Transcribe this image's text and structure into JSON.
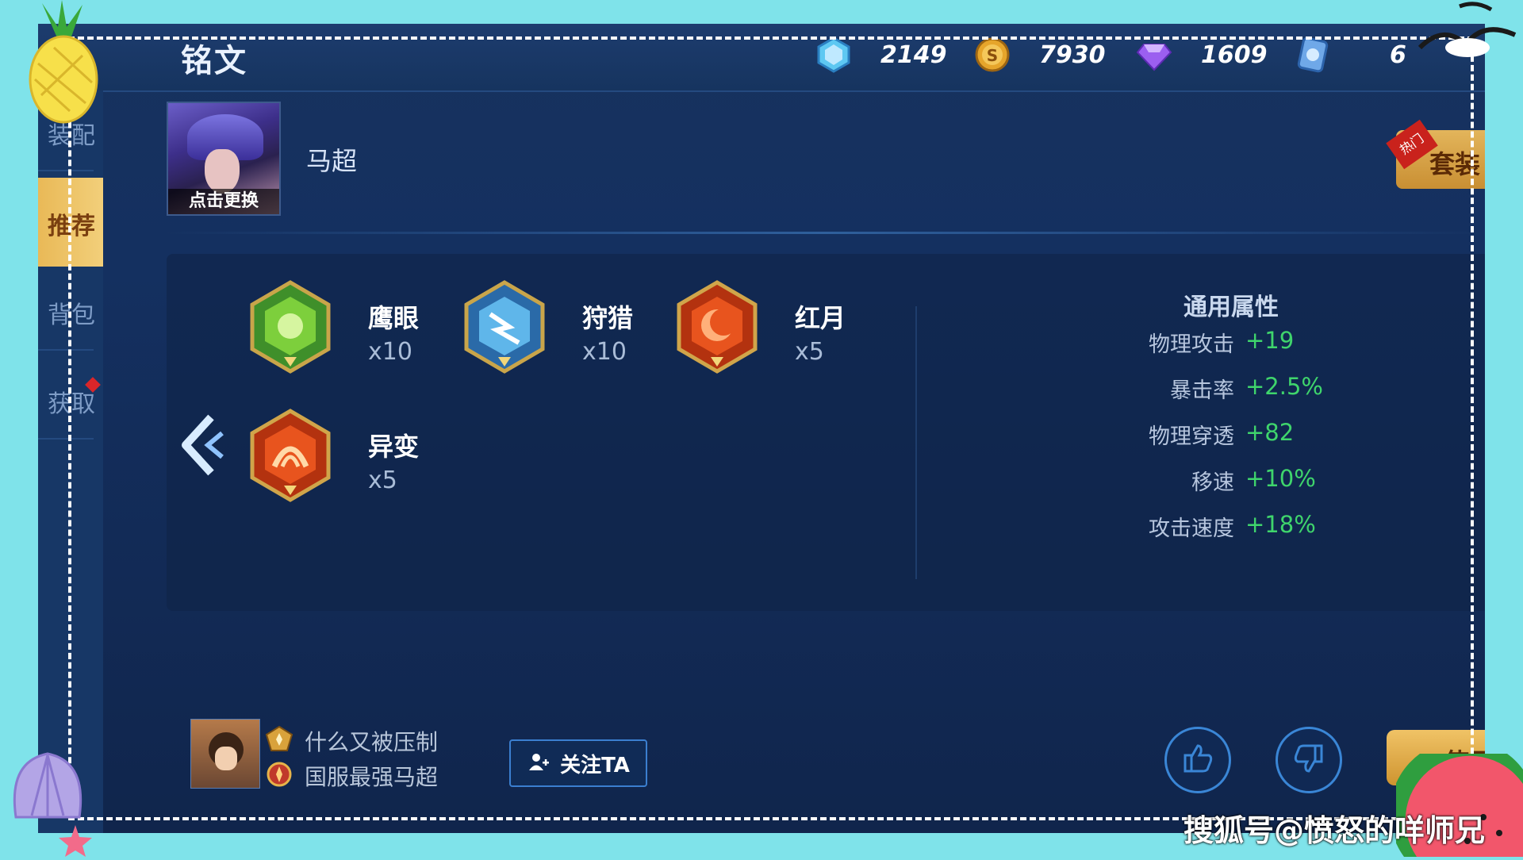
{
  "header": {
    "title": "铭文",
    "currencies": [
      {
        "icon": "blue-crystal-icon",
        "value": "2149"
      },
      {
        "icon": "gold-coin-icon",
        "value": "7930"
      },
      {
        "icon": "purple-diamond-icon",
        "value": "1609"
      },
      {
        "icon": "blue-coupon-icon",
        "value": "6"
      }
    ]
  },
  "sidebar": {
    "items": [
      {
        "label": "装配"
      },
      {
        "label": "推荐"
      },
      {
        "label": "背包"
      },
      {
        "label": "获取"
      }
    ],
    "active_index": 1
  },
  "hero": {
    "name": "马超",
    "change_label": "点击更换"
  },
  "hot_tab": {
    "badge": "热门",
    "label": "套装"
  },
  "runes": [
    {
      "name": "鹰眼",
      "count": "x10",
      "color": "green"
    },
    {
      "name": "狩猎",
      "count": "x10",
      "color": "blue"
    },
    {
      "name": "红月",
      "count": "x5",
      "color": "red"
    },
    {
      "name": "异变",
      "count": "x5",
      "color": "red"
    }
  ],
  "stats": {
    "title": "通用属性",
    "rows": [
      {
        "label": "物理攻击",
        "value": "+19"
      },
      {
        "label": "暴击率",
        "value": "+2.5%"
      },
      {
        "label": "物理穿透",
        "value": "+82"
      },
      {
        "label": "移速",
        "value": "+10%"
      },
      {
        "label": "攻击速度",
        "value": "+18%"
      }
    ]
  },
  "author": {
    "line1": "什么又被压制",
    "line2": "国服最强马超",
    "follow_label": "关注TA"
  },
  "actions": {
    "use_label": "使用"
  },
  "watermark": "搜狐号@愤怒的咩师兄",
  "colors": {
    "background": "#7fe3ea",
    "panel": "#143060",
    "stat_value": "#3fd56c",
    "gold_button": "#e3b55b"
  }
}
